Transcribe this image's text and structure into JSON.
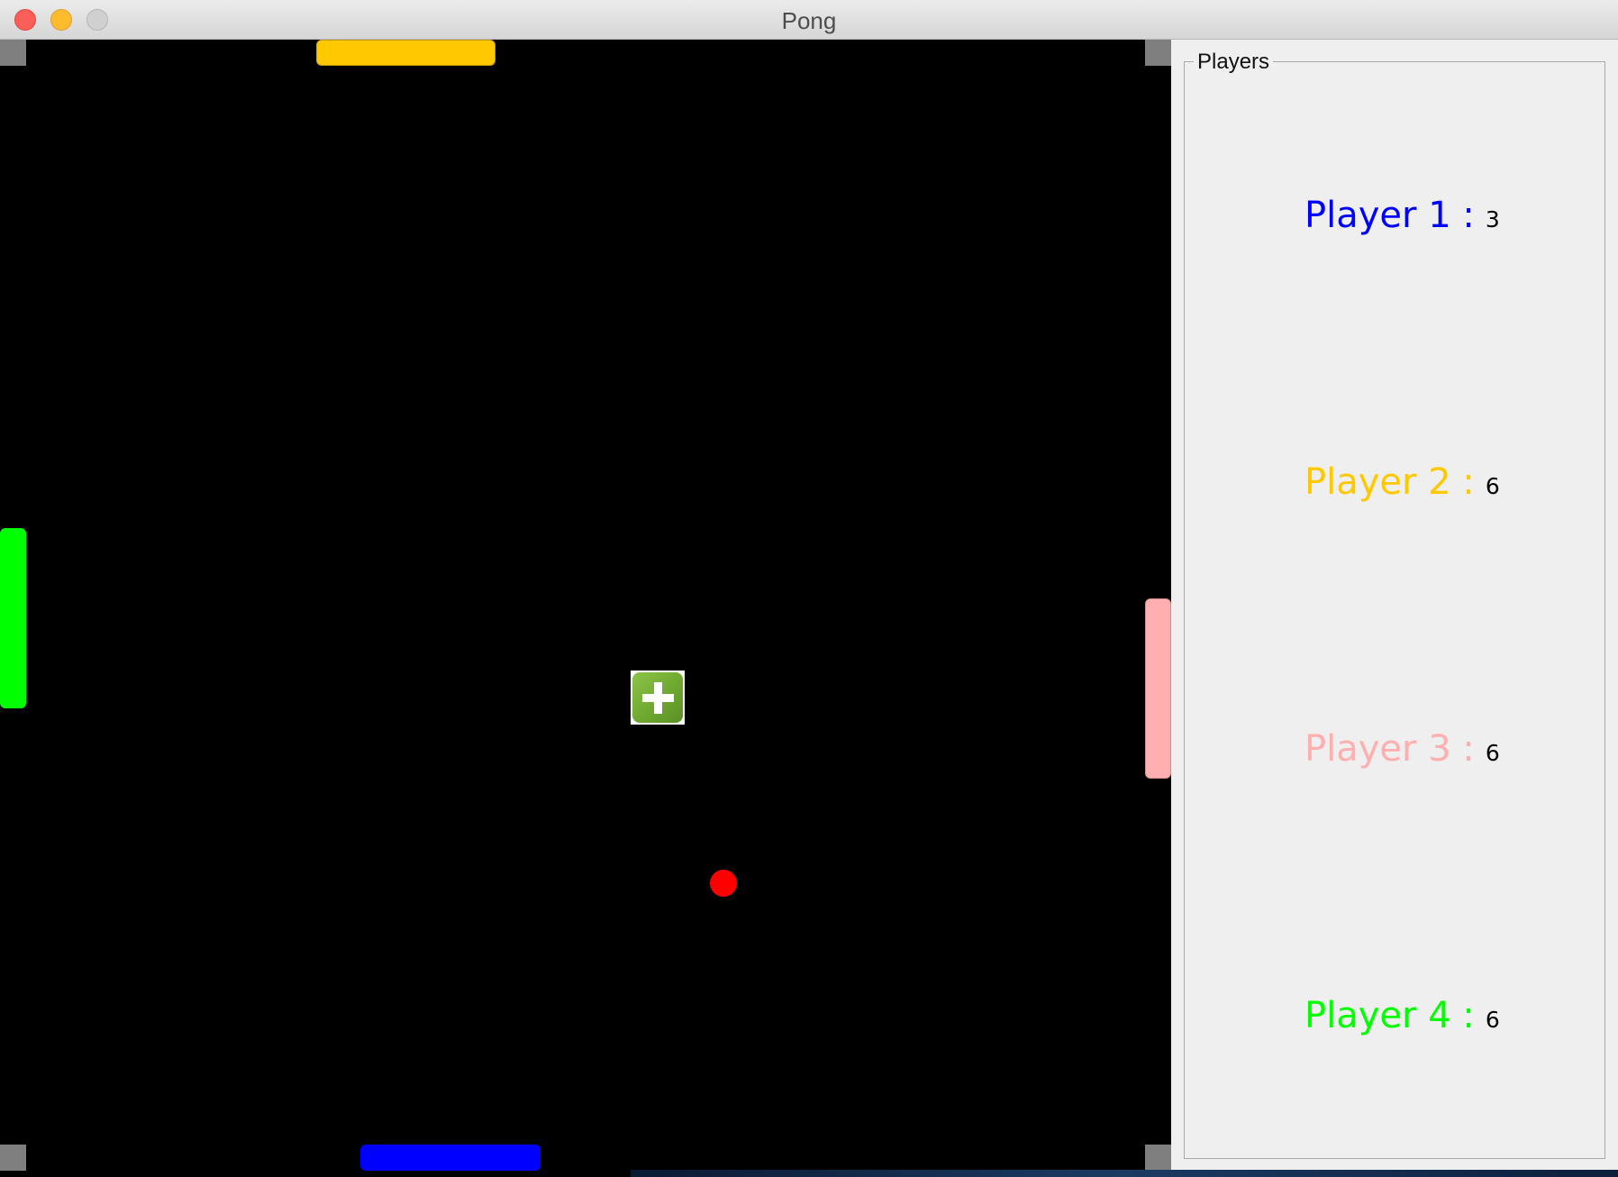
{
  "window": {
    "title": "Pong"
  },
  "game": {
    "paddle_colors": {
      "top": "#ffc800",
      "bottom": "#0000ff",
      "left": "#00ff00",
      "right": "#ffafaf"
    },
    "ball_color": "#ff0000",
    "powerup_icon": "plus-icon"
  },
  "players_panel": {
    "title": "Players",
    "players": [
      {
        "label": "Player 1 :",
        "score": "3",
        "color": "#0000ff"
      },
      {
        "label": "Player 2 :",
        "score": "6",
        "color": "#ffc800"
      },
      {
        "label": "Player 3 :",
        "score": "6",
        "color": "#ffafaf"
      },
      {
        "label": "Player 4 :",
        "score": "6",
        "color": "#00ff00"
      }
    ]
  }
}
